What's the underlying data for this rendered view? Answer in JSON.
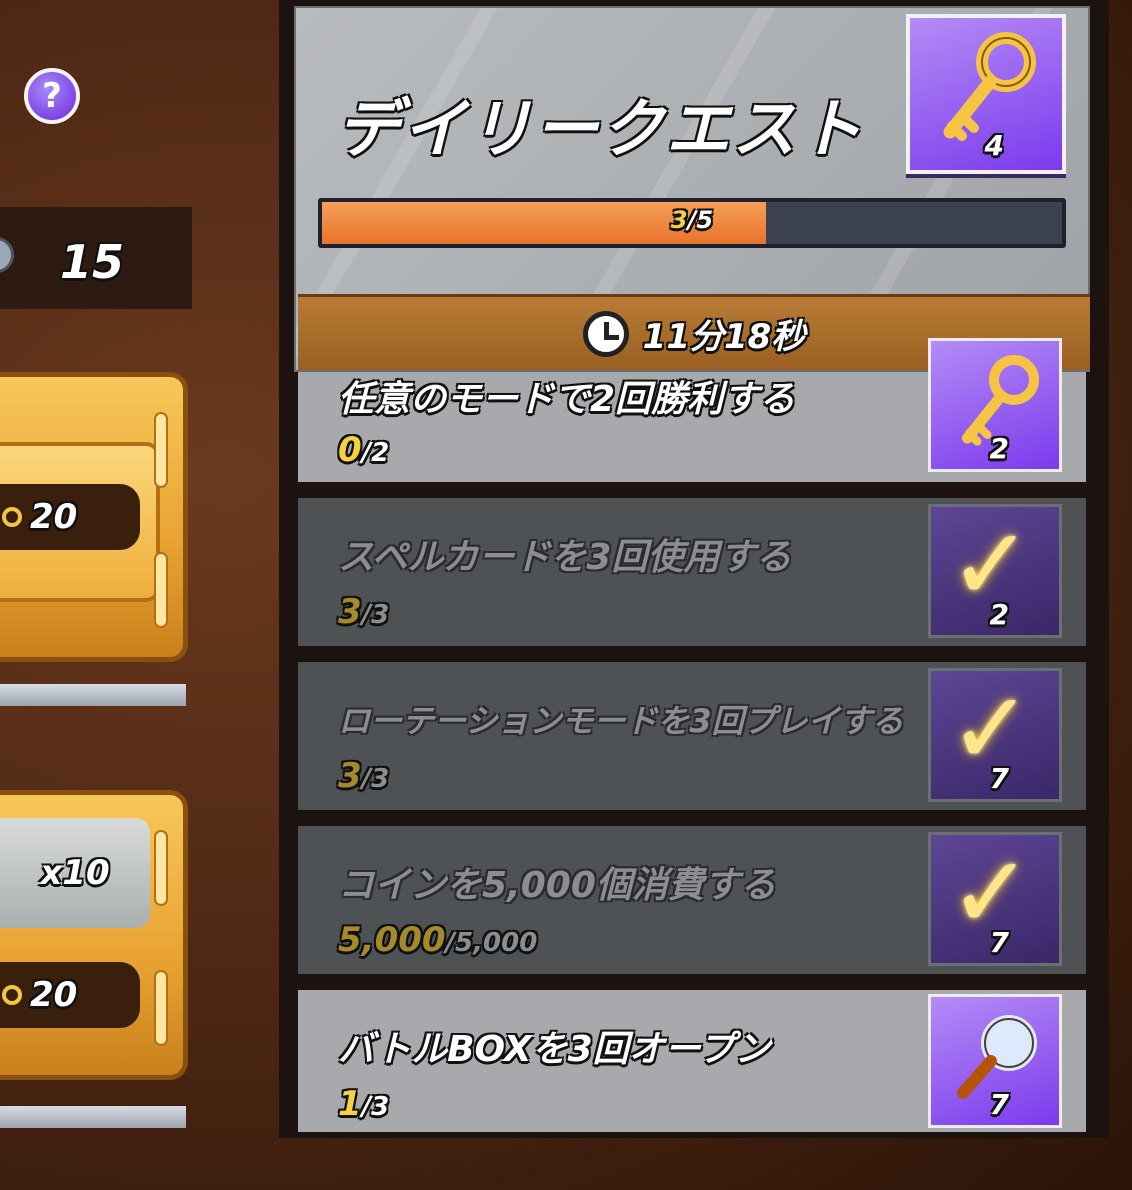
{
  "left": {
    "help_label": "?",
    "currency_value": "15",
    "chests": [
      {
        "cost": "20"
      },
      {
        "multiplier": "x10",
        "cost": "20"
      }
    ]
  },
  "header": {
    "title": "デイリークエスト",
    "reward_icon": "key-icon",
    "reward_count": "4",
    "progress": {
      "current": "3",
      "total": "5",
      "label_current": "3",
      "label_sep": "/5",
      "fraction": 0.6
    },
    "timer": "11分18秒"
  },
  "quests": [
    {
      "title": "任意のモードで2回勝利する",
      "current": "0",
      "total": "/2",
      "reward_icon": "key-icon",
      "reward_count": "2",
      "done": false
    },
    {
      "title": "スペルカードを3回使用する",
      "current": "3",
      "total": "/3",
      "reward_icon": "key-icon",
      "reward_count": "2",
      "done": true
    },
    {
      "title": "ローテーションモードを3回プレイする",
      "current": "3",
      "total": "/3",
      "reward_icon": "magnifier-icon",
      "reward_count": "7",
      "done": true
    },
    {
      "title": "コインを5,000個消費する",
      "current": "5,000",
      "total": "/5,000",
      "reward_icon": "magnifier-icon",
      "reward_count": "7",
      "done": true
    },
    {
      "title": "バトルBOXを3回オープン",
      "current": "1",
      "total": "/3",
      "reward_icon": "magnifier-icon",
      "reward_count": "7",
      "done": false
    }
  ],
  "colors": {
    "accent_purple": "#7c3aed",
    "progress_orange": "#e8732a",
    "timer_bar": "#9a5f22"
  }
}
